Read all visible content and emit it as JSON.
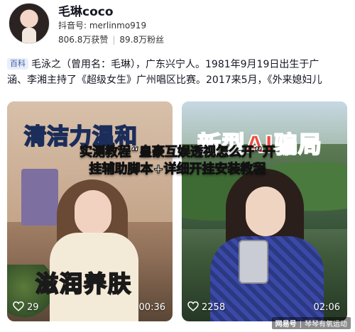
{
  "profile": {
    "name": "毛琳coco",
    "douyin_id": "抖音号: merlinmo919",
    "likes": "806.8万获赞",
    "fans": "89.8万粉丝"
  },
  "bio": {
    "tag": "百科",
    "line1": "毛泳之（曾用名：毛琳），广东兴宁人。1981年9月19日出生于广",
    "line2": "涵、李湘主持了《超级女生》广州唱区比赛。2017来5月，《外来媳妇儿"
  },
  "overlay_title": {
    "line1": "实测教程“皇豪互娱透视怎么开”开",
    "line2": "挂辅助脚本+详细开挂安装教程"
  },
  "videos": [
    {
      "caption_top": "清洁力温和",
      "caption_bottom": "滋润养肤",
      "likes": "29",
      "duration": "00:36"
    },
    {
      "caption_top": "新型AI骗局",
      "likes": "2258",
      "duration": "02:06"
    }
  ],
  "watermark": {
    "site": "网易号",
    "author": "琴琴有氧运动"
  },
  "colors": {
    "accent_cyan": "#7fd6e8",
    "accent_red": "#f04a3e"
  }
}
